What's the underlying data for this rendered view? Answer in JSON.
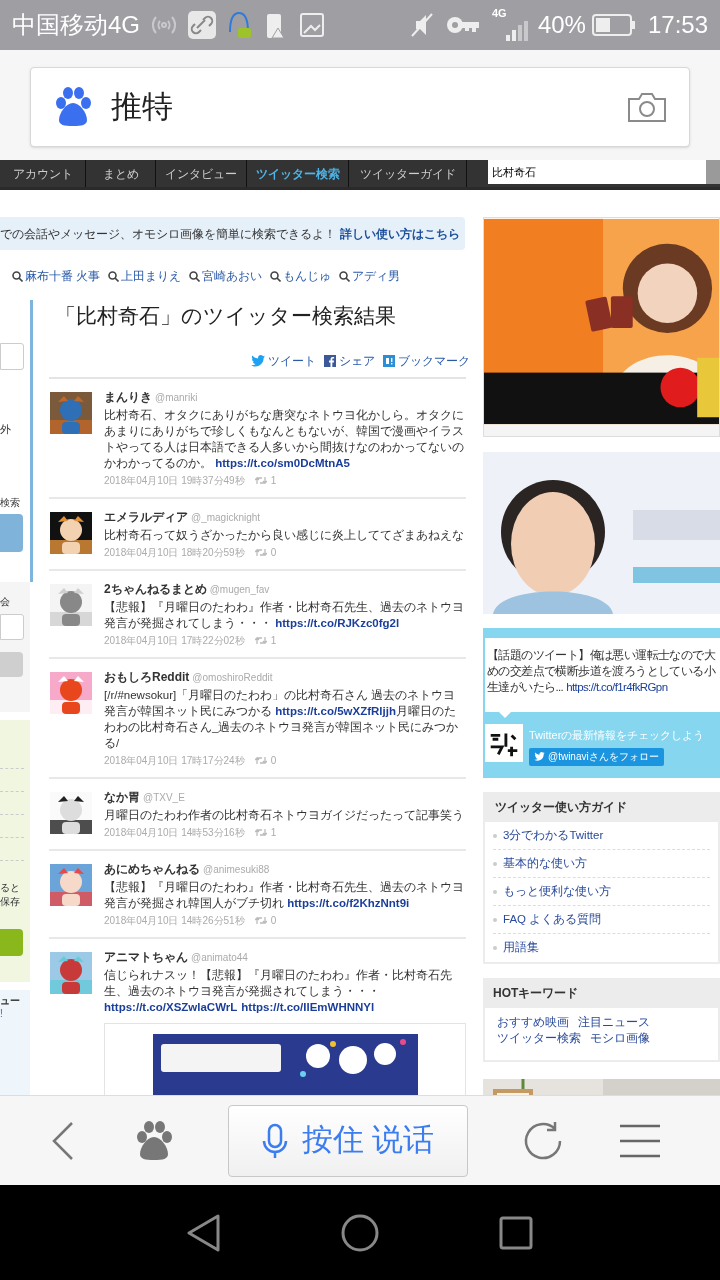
{
  "status_bar": {
    "carrier": "中国移动4G",
    "network": "4G",
    "battery": "40%",
    "time": "17:53"
  },
  "search_box": {
    "query": "推特"
  },
  "site_nav": {
    "tabs": [
      {
        "label": "アカウント",
        "selected": false
      },
      {
        "label": "まとめ",
        "selected": false
      },
      {
        "label": "インタビュー",
        "selected": false
      },
      {
        "label": "ツイッター検索",
        "selected": true
      },
      {
        "label": "ツイッターガイド",
        "selected": false
      }
    ],
    "search_value": "比村奇石"
  },
  "info_banner": {
    "text": "での会話やメッセージ、オモシロ画像を簡単に検索できるよ！",
    "link": "詳しい使い方はこちら"
  },
  "keywords": [
    "麻布十番 火事",
    "上田まりえ",
    "宮崎あおい",
    "もんじゅ",
    "アディ男"
  ],
  "sidebar_fragments": [
    "外",
    "検索",
    "会",
    "ると",
    "保存",
    "ュー",
    "!"
  ],
  "results": {
    "title": "「比村奇石」のツイッター検索結果",
    "share": [
      {
        "kind": "twitter",
        "label": "ツイート"
      },
      {
        "kind": "facebook",
        "label": "シェア"
      },
      {
        "kind": "hatena",
        "label": "ブックマーク"
      }
    ],
    "tweets": [
      {
        "name": "まんりき",
        "handle": "@manriki",
        "body": [
          {
            "kind": "text",
            "text": "比村奇石、オタクにありがちな唐突なネトウヨ化かしら。オタクにあまりにありがちで珍しくもなんともないが、韓国で漫画やイラストやってる人は日本語できる人多いから間抜けなのわかってないのかわかってるのか。 "
          },
          {
            "kind": "link",
            "text": "https://t.co/sm0DcMtnA5"
          }
        ],
        "date": "2018年04月10日 19時37分49秒",
        "retweets": "1"
      },
      {
        "name": "エメラルディア",
        "handle": "@_magicknight",
        "body": [
          {
            "kind": "text",
            "text": "比村奇石って奴うざかったから良い感じに炎上しててざまあねえな"
          }
        ],
        "date": "2018年04月10日 18時20分59秒",
        "retweets": "0"
      },
      {
        "name": "2ちゃんねるまとめ",
        "handle": "@mugen_fav",
        "body": [
          {
            "kind": "text",
            "text": "【悲報】『月曜日のたわわ』作者・比村奇石先生、過去のネトウヨ発言が発掘されてしまう・・・ "
          },
          {
            "kind": "link",
            "text": "https://t.co/RJKzc0fg2l"
          }
        ],
        "date": "2018年04月10日 17時22分02秒",
        "retweets": "1"
      },
      {
        "name": "おもしろReddit",
        "handle": "@omoshiroReddit",
        "body": [
          {
            "kind": "text",
            "text": "[/r/#newsokur]「月曜日のたわわ」の比村奇石さん 過去のネトウヨ発言が韓国ネット民にみつかる "
          },
          {
            "kind": "link",
            "text": "https://t.co/5wXZfRljjh"
          },
          {
            "kind": "text",
            "text": "月曜日のたわわの比村奇石さん_過去のネトウヨ発言が韓国ネット民にみつかる/"
          }
        ],
        "date": "2018年04月10日 17時17分24秒",
        "retweets": "0"
      },
      {
        "name": "なか胃",
        "handle": "@TXV_E",
        "body": [
          {
            "kind": "text",
            "text": "月曜日のたわわ作者の比村奇石ネトウヨガイジだったって記事笑う"
          }
        ],
        "date": "2018年04月10日 14時53分16秒",
        "retweets": "1"
      },
      {
        "name": "あにめちゃんねる",
        "handle": "@animesuki88",
        "body": [
          {
            "kind": "text",
            "text": "【悲報】『月曜日のたわわ』作者・比村奇石先生、過去のネトウヨ発言が発掘され韓国人がブチ切れ "
          },
          {
            "kind": "link",
            "text": "https://t.co/f2KhzNnt9i"
          }
        ],
        "date": "2018年04月10日 14時26分51秒",
        "retweets": "0"
      },
      {
        "name": "アニマトちゃん",
        "handle": "@animato44",
        "body": [
          {
            "kind": "text",
            "text": "信じられナスッ！【悲報】『月曜日のたわわ』作者・比村奇石先生、過去のネトウヨ発言が発掘されてしまう・・・ "
          },
          {
            "kind": "link",
            "text": "https://t.co/XSZwlaCWrL"
          },
          {
            "kind": "link",
            "text": "https://t.co/IlEmWHNNYl"
          }
        ],
        "card": {
          "kind": "picture"
        }
      }
    ]
  },
  "twitter_box": {
    "lines": [
      "【話題のツイート】俺は悪い運転士なので大",
      "めの交差点で横断歩道を渡ろうとしている小",
      "生達がいたら..."
    ],
    "link": "https://t.co/f1r4fkRGpn",
    "promo": "Twitterの最新情報をチェックしよう",
    "follow": "@twinaviさんをフォロー"
  },
  "guide": {
    "title": "ツイッター使い方ガイド",
    "items": [
      "3分でわかるTwitter",
      "基本的な使い方",
      "もっと便利な使い方",
      "FAQ よくある質問",
      "用語集"
    ]
  },
  "hot_keywords": {
    "title": "HOTキーワード",
    "items": [
      "おすすめ映画",
      "注目ニュース",
      "ツイッター検索",
      "モシロ画像"
    ]
  },
  "voice_button": "按住 说话"
}
